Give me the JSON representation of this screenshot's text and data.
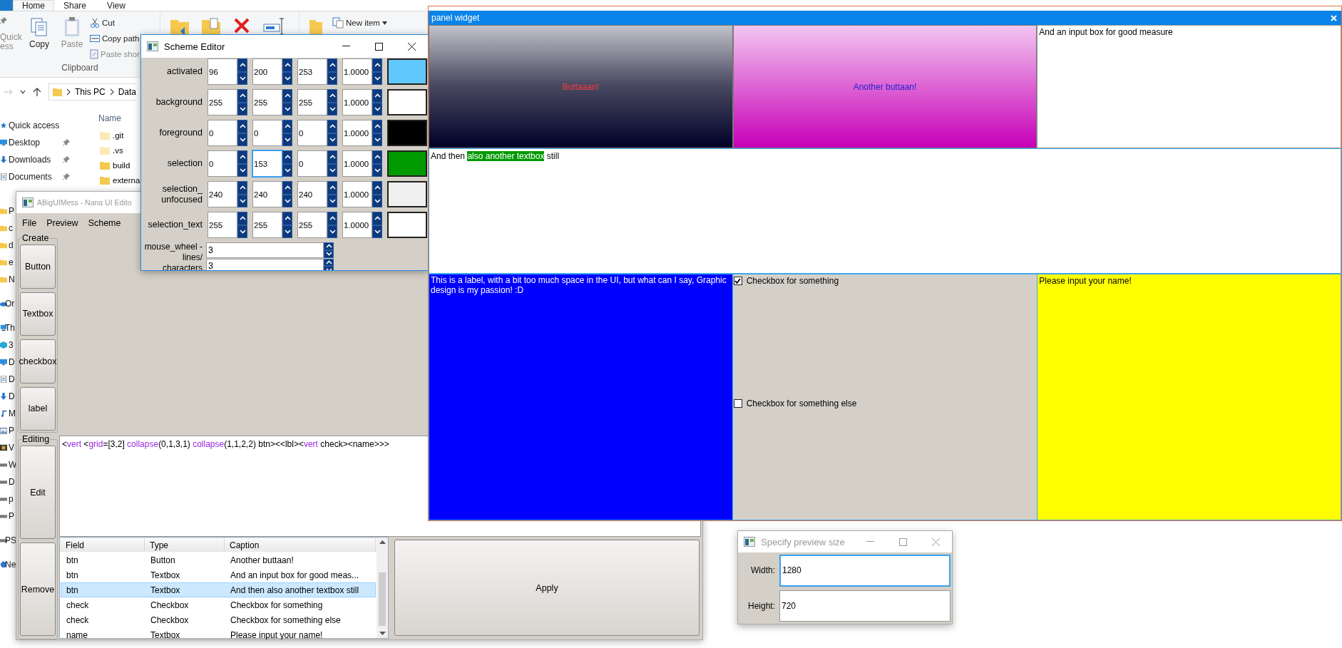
{
  "explorer": {
    "ribbon_tabs": [
      {
        "label": "Home",
        "selected": true
      },
      {
        "label": "Share",
        "selected": false
      },
      {
        "label": "View",
        "selected": false
      }
    ],
    "pin_label": "Quick\ness",
    "clipboard": {
      "large": [
        {
          "label": "Copy",
          "disabled": false
        },
        {
          "label": "Paste",
          "disabled": true
        }
      ],
      "small": [
        {
          "label": "Cut",
          "disabled": false
        },
        {
          "label": "Copy path",
          "disabled": false
        },
        {
          "label": "Paste shor",
          "disabled": true
        }
      ],
      "group_label": "Clipboard"
    },
    "new_item": "New item",
    "path": [
      "This PC",
      "Data"
    ],
    "column": "Name",
    "files": [
      ".git",
      ".vs",
      "build",
      "externa"
    ],
    "nav_groups": [
      {
        "items": [
          {
            "label": "Quick access",
            "kind": "star",
            "pinned": false
          },
          {
            "label": "Desktop",
            "kind": "desktop",
            "pinned": true
          },
          {
            "label": "Downloads",
            "kind": "download",
            "pinned": true
          },
          {
            "label": "Documents",
            "kind": "document",
            "pinned": true
          },
          {
            "label": "P",
            "kind": "folder",
            "pinned": false
          },
          {
            "label": "c",
            "kind": "folder",
            "pinned": false
          },
          {
            "label": "d",
            "kind": "folder",
            "pinned": false
          },
          {
            "label": "e",
            "kind": "folder",
            "pinned": false
          },
          {
            "label": "N",
            "kind": "folder",
            "pinned": false
          }
        ]
      },
      {
        "items": [
          {
            "label": "Or",
            "kind": "cloud",
            "pinned": false
          }
        ]
      },
      {
        "items": [
          {
            "label": "Th",
            "kind": "pc",
            "pinned": false
          },
          {
            "label": "3",
            "kind": "cube",
            "pinned": false
          },
          {
            "label": "D",
            "kind": "desktop",
            "pinned": false
          },
          {
            "label": "D",
            "kind": "document",
            "pinned": false
          },
          {
            "label": "D",
            "kind": "download",
            "pinned": false
          },
          {
            "label": "M",
            "kind": "music",
            "pinned": false
          },
          {
            "label": "P",
            "kind": "pictures",
            "pinned": false
          },
          {
            "label": "V",
            "kind": "video",
            "pinned": false
          },
          {
            "label": "W",
            "kind": "drive",
            "pinned": false
          },
          {
            "label": "D",
            "kind": "drive",
            "pinned": false
          },
          {
            "label": "p",
            "kind": "drive",
            "pinned": false
          },
          {
            "label": "P",
            "kind": "drive",
            "pinned": false
          }
        ]
      },
      {
        "items": [
          {
            "label": "PS",
            "kind": "drive",
            "pinned": false
          }
        ]
      },
      {
        "items": [
          {
            "label": "Ne",
            "kind": "network",
            "pinned": false
          }
        ]
      }
    ]
  },
  "editor": {
    "title": "ABigUIMess - Nana UI Edito",
    "menu": [
      "File",
      "Preview",
      "Scheme"
    ],
    "create_group": {
      "label": "Create",
      "buttons": [
        "Button",
        "Textbox",
        "checkbox",
        "label"
      ]
    },
    "editing_group": {
      "label": "Editing",
      "buttons": [
        "Edit",
        "Remove"
      ]
    },
    "layout_tokens": [
      {
        "text": "<",
        "kind": "plain"
      },
      {
        "text": "vert",
        "kind": "keyword"
      },
      {
        "text": " <",
        "kind": "plain"
      },
      {
        "text": "grid",
        "kind": "keyword"
      },
      {
        "text": "=[3,2] ",
        "kind": "plain"
      },
      {
        "text": "collapse",
        "kind": "keyword"
      },
      {
        "text": "(0,1,3,1) ",
        "kind": "plain"
      },
      {
        "text": "collapse",
        "kind": "keyword"
      },
      {
        "text": "(1,1,2,2) btn><<lbl><",
        "kind": "plain"
      },
      {
        "text": "vert",
        "kind": "keyword"
      },
      {
        "text": " check><name>>>",
        "kind": "plain"
      }
    ],
    "table": {
      "columns": [
        "Field",
        "Type",
        "Caption"
      ],
      "rows": [
        {
          "cells": [
            "btn",
            "Button",
            "Another buttaan!"
          ],
          "selected": false
        },
        {
          "cells": [
            "btn",
            "Textbox",
            "And an input box for good meas..."
          ],
          "selected": false
        },
        {
          "cells": [
            "btn",
            "Textbox",
            "And then also another textbox still"
          ],
          "selected": true
        },
        {
          "cells": [
            "check",
            "Checkbox",
            "Checkbox for something"
          ],
          "selected": false
        },
        {
          "cells": [
            "check",
            "Checkbox",
            "Checkbox for something else"
          ],
          "selected": false
        },
        {
          "cells": [
            "name",
            "Textbox",
            "Please input your name!"
          ],
          "selected": false
        }
      ]
    },
    "apply": "Apply"
  },
  "scheme_editor": {
    "title": "Scheme Editor",
    "rows": [
      {
        "label": "activated",
        "color": "#60c8fd",
        "values": [
          {
            "value": "96",
            "focused": false
          },
          {
            "value": "200",
            "focused": false
          },
          {
            "value": "253",
            "focused": false
          },
          {
            "value": "1.0000",
            "focused": false
          }
        ]
      },
      {
        "label": "background",
        "color": "#ffffff",
        "values": [
          {
            "value": "255",
            "focused": false
          },
          {
            "value": "255",
            "focused": false
          },
          {
            "value": "255",
            "focused": false
          },
          {
            "value": "1.0000",
            "focused": false
          }
        ]
      },
      {
        "label": "foreground",
        "color": "#000000",
        "values": [
          {
            "value": "0",
            "focused": false
          },
          {
            "value": "0",
            "focused": false
          },
          {
            "value": "0",
            "focused": false
          },
          {
            "value": "1.0000",
            "focused": false
          }
        ]
      },
      {
        "label": "selection",
        "color": "#009900",
        "values": [
          {
            "value": "0",
            "focused": false
          },
          {
            "value": "153",
            "focused": true
          },
          {
            "value": "0",
            "focused": false
          },
          {
            "value": "1.0000",
            "focused": false
          }
        ]
      },
      {
        "label": "selection_\nunfocused",
        "color": "#f0f0f0",
        "values": [
          {
            "value": "240",
            "focused": false
          },
          {
            "value": "240",
            "focused": false
          },
          {
            "value": "240",
            "focused": false
          },
          {
            "value": "1.0000",
            "focused": false
          }
        ]
      },
      {
        "label": "selection_text",
        "color": "#ffffff",
        "values": [
          {
            "value": "255",
            "focused": false
          },
          {
            "value": "255",
            "focused": false
          },
          {
            "value": "255",
            "focused": false
          },
          {
            "value": "1.0000",
            "focused": false
          }
        ]
      }
    ],
    "mouse_wheel": {
      "label": "mouse_wheel -\nlines/\ncharacters",
      "values": [
        "3",
        "3"
      ]
    }
  },
  "panel": {
    "title": "panel widget",
    "buttons": [
      {
        "label": "Buttaaan!"
      },
      {
        "label": "Another buttaan!"
      }
    ],
    "input_box": "And an input box for good measure",
    "textbox_parts": [
      {
        "text": "And then ",
        "selected": false
      },
      {
        "text": "also another textbox",
        "selected": true
      },
      {
        "text": " still",
        "selected": false
      }
    ],
    "label": "This is a label, with a bit too much space in the UI, but what can I say, Graphic design is my passion! :D",
    "checkboxes": [
      {
        "label": "Checkbox for something",
        "checked": true
      },
      {
        "label": "Checkbox for something else",
        "checked": false
      }
    ],
    "name_box": "Please input your name!"
  },
  "preview_dialog": {
    "title": "Specify preview size",
    "fields": [
      {
        "label": "Width:",
        "value": "1280",
        "focused": true
      },
      {
        "label": "Height:",
        "value": "720",
        "focused": false
      }
    ]
  }
}
